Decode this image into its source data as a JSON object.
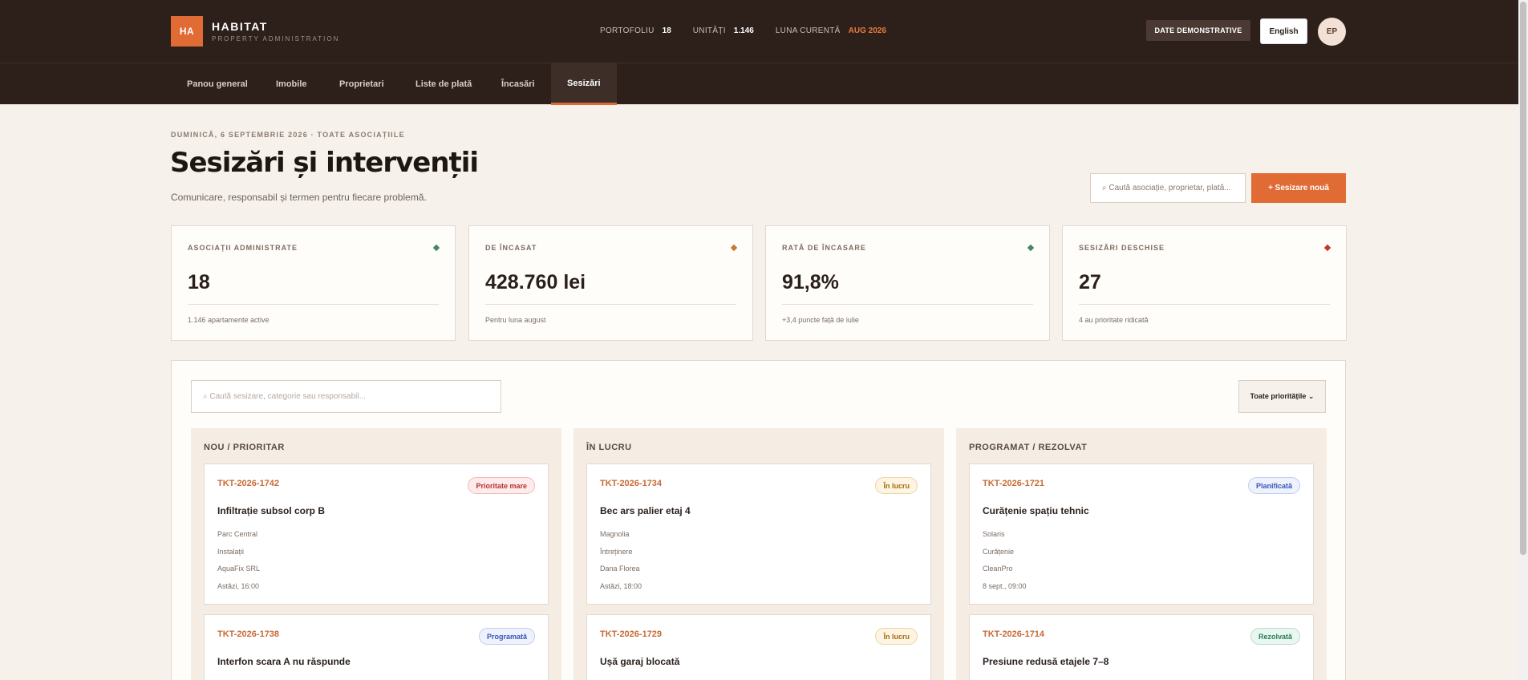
{
  "brand": {
    "badge": "HA",
    "name": "HABITAT",
    "sub": "PROPERTY ADMINISTRATION"
  },
  "header_stats": [
    {
      "label": "PORTOFOLIU",
      "value": "18"
    },
    {
      "label": "UNITĂȚI",
      "value": "1.146"
    },
    {
      "label": "LUNA CURENTĂ",
      "value": "AUG 2026"
    }
  ],
  "header": {
    "demo": "DATE DEMONSTRATIVE",
    "lang": "English",
    "avatar": "EP"
  },
  "nav": [
    "Panou general",
    "Imobile",
    "Proprietari",
    "Liste de plată",
    "Încasări",
    "Sesizări"
  ],
  "page": {
    "date": "DUMINICĂ, 6 SEPTEMBRIE 2026 · TOATE ASOCIAȚIILE",
    "title": "Sesizări și intervenții",
    "subtitle": "Comunicare, responsabil și termen pentru fiecare problemă.",
    "search_placeholder": "⌕ Caută asociație, proprietar, plată...",
    "new_button": "+ Sesizare nouă"
  },
  "kpis": [
    {
      "label": "ASOCIAȚII ADMINISTRATE",
      "value": "18",
      "note": "1.146 apartamente active",
      "color": "#3f8a5f"
    },
    {
      "label": "DE ÎNCASAT",
      "value": "428.760 lei",
      "note": "Pentru luna august",
      "color": "#c77a34"
    },
    {
      "label": "RATĂ DE ÎNCASARE",
      "value": "91,8%",
      "note": "+3,4 puncte față de iulie",
      "color": "#3f8a5f"
    },
    {
      "label": "SESIZĂRI DESCHISE",
      "value": "27",
      "note": "4 au prioritate ridicată",
      "color": "#c0392b"
    }
  ],
  "board": {
    "search_placeholder": "⌕  Caută sesizare, categorie sau responsabil...",
    "priority_filter": "Toate prioritățile ⌄"
  },
  "columns": [
    {
      "title": "NOU / PRIORITAR",
      "tickets": [
        {
          "id": "TKT-2026-1742",
          "badge": "Prioritate mare",
          "tone": "red",
          "title": "Infiltrație subsol corp B",
          "meta": [
            "Parc Central",
            "Instalații",
            "AquaFix SRL",
            "Astăzi, 16:00"
          ]
        },
        {
          "id": "TKT-2026-1738",
          "badge": "Programată",
          "tone": "blue",
          "title": "Interfon scara A nu răspunde",
          "meta": []
        }
      ]
    },
    {
      "title": "ÎN LUCRU",
      "tickets": [
        {
          "id": "TKT-2026-1734",
          "badge": "În lucru",
          "tone": "yellow",
          "title": "Bec ars palier etaj 4",
          "meta": [
            "Magnolia",
            "Întreținere",
            "Dana Florea",
            "Astăzi, 18:00"
          ]
        },
        {
          "id": "TKT-2026-1729",
          "badge": "În lucru",
          "tone": "yellow",
          "title": "Ușă garaj blocată",
          "meta": []
        }
      ]
    },
    {
      "title": "PROGRAMAT / REZOLVAT",
      "tickets": [
        {
          "id": "TKT-2026-1721",
          "badge": "Planificată",
          "tone": "blue",
          "title": "Curățenie spațiu tehnic",
          "meta": [
            "Solaris",
            "Curățenie",
            "CleanPro",
            "8 sept., 09:00"
          ]
        },
        {
          "id": "TKT-2026-1714",
          "badge": "Rezolvată",
          "tone": "green",
          "title": "Presiune redusă etajele 7–8",
          "meta": []
        }
      ]
    }
  ]
}
